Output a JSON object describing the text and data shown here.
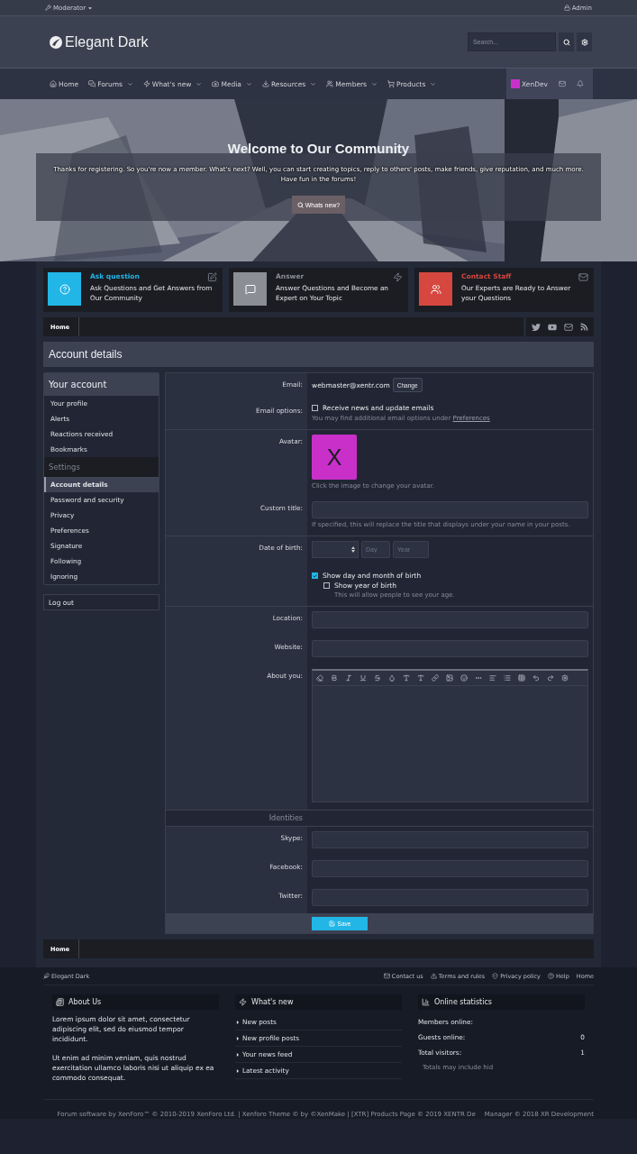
{
  "top_bar": {
    "left": "Moderator",
    "right": "Admin"
  },
  "header": {
    "logo": "Elegant Dark",
    "search_placeholder": "Search..."
  },
  "nav": {
    "items": [
      {
        "label": "Home",
        "dropdown": false
      },
      {
        "label": "Forums",
        "dropdown": true
      },
      {
        "label": "What's new",
        "dropdown": true
      },
      {
        "label": "Media",
        "dropdown": true
      },
      {
        "label": "Resources",
        "dropdown": true
      },
      {
        "label": "Members",
        "dropdown": true
      },
      {
        "label": "Products",
        "dropdown": true
      }
    ],
    "user": "XenDev"
  },
  "hero": {
    "title": "Welcome to Our Community",
    "text": "Thanks for registering. So you're now a member. What's next? Well, you can start creating topics, reply to others' posts, make friends, give reputation, and much more. Have fun in the forums!",
    "button": "Whats new?"
  },
  "features": [
    {
      "title": "Ask question",
      "text": "Ask Questions and Get Answers from Our Community",
      "color": "#22b6e6"
    },
    {
      "title": "Answer",
      "text": "Answer Questions and Become an Expert on Your Topic",
      "color": "#8b8e94"
    },
    {
      "title": "Contact Staff",
      "text": "Our Experts are Ready to Answer your Questions",
      "color": "#d5473f"
    }
  ],
  "breadcrumb": "Home",
  "page_title": "Account details",
  "sidebar": {
    "sections": [
      {
        "title": "Your account",
        "items": [
          {
            "label": "Your profile",
            "selected": false
          },
          {
            "label": "Alerts",
            "selected": false
          },
          {
            "label": "Reactions received",
            "selected": false
          },
          {
            "label": "Bookmarks",
            "selected": false
          }
        ]
      },
      {
        "title": "Settings",
        "items": [
          {
            "label": "Account details",
            "selected": true
          },
          {
            "label": "Password and security",
            "selected": false
          },
          {
            "label": "Privacy",
            "selected": false
          },
          {
            "label": "Preferences",
            "selected": false
          },
          {
            "label": "Signature",
            "selected": false
          },
          {
            "label": "Following",
            "selected": false
          },
          {
            "label": "Ignoring",
            "selected": false
          }
        ]
      }
    ],
    "logout": "Log out"
  },
  "form": {
    "rows": [
      {
        "kind": "email",
        "label": "Email:",
        "value": "webmaster@xentr.com",
        "button": "Change"
      },
      {
        "kind": "checks",
        "label": "Email options:",
        "options": [
          {
            "label": "Receive news and update emails",
            "checked": false
          }
        ],
        "hint": "You may find additional email options under",
        "hint_link": "Preferences"
      },
      {
        "kind": "avatar",
        "label": "Avatar:",
        "letter": "X",
        "hint": "Click the image to change your avatar."
      },
      {
        "kind": "input",
        "label": "Custom title:",
        "hint": "If specified, this will replace the title that displays under your name in your posts."
      },
      {
        "kind": "dob",
        "label": "Date of birth:",
        "day_placeholder": "Day",
        "year_placeholder": "Year",
        "options": [
          {
            "label": "Show day and month of birth",
            "checked": true,
            "children": [
              {
                "label": "Show year of birth",
                "checked": false,
                "hint": "This will allow people to see your age."
              }
            ]
          }
        ]
      },
      {
        "kind": "input",
        "label": "Location:"
      },
      {
        "kind": "input",
        "label": "Website:"
      },
      {
        "kind": "editor",
        "label": "About you:"
      },
      {
        "kind": "section",
        "label": "Identities"
      },
      {
        "kind": "input",
        "label": "Skype:"
      },
      {
        "kind": "input",
        "label": "Facebook:"
      },
      {
        "kind": "input",
        "label": "Twitter:"
      }
    ],
    "save": "Save"
  },
  "bottom_breadcrumb": "Home",
  "footer": {
    "brand": "Elegant Dark",
    "links": [
      "Contact us",
      "Terms and rules",
      "Privacy policy",
      "Help",
      "Home"
    ],
    "about": {
      "title": "About Us",
      "paragraphs": [
        "Lorem ipsum dolor sit amet, consectetur adipiscing elit, sed do eiusmod tempor incididunt.",
        "Ut enim ad minim veniam, quis nostrud exercitation ullamco laboris nisi ut aliquip ex ea commodo consequat."
      ]
    },
    "whats_new": {
      "title": "What's new",
      "items": [
        "New posts",
        "New profile posts",
        "Your news feed",
        "Latest activity"
      ]
    },
    "stats": {
      "title": "Online statistics",
      "rows": [
        {
          "label": "Members online:"
        },
        {
          "label": "Guests online:",
          "value": "0"
        },
        {
          "label": "Total visitors:",
          "value": "1"
        }
      ],
      "note": "Totals may include hid"
    },
    "copyright": [
      "Forum software by XenForo™ © 2010-2019 XenForo Ltd. | Xenforo Theme © by ©XenMake | [XTR] Products Page © 2019 XENTR De",
      "Manager © 2018 XR Development"
    ]
  }
}
